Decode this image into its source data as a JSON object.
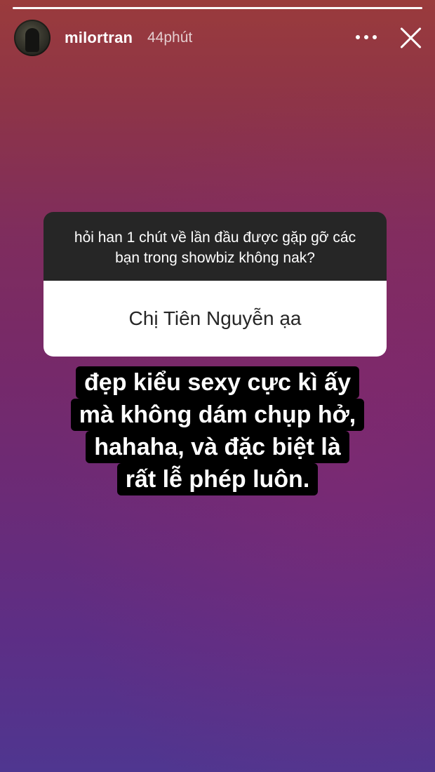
{
  "story": {
    "progress_fraction": 1.0
  },
  "header": {
    "username": "milortran",
    "timestamp": "44phút",
    "more_icon": "more-horizontal-icon",
    "close_icon": "close-icon"
  },
  "question_card": {
    "question": "hỏi han 1 chút về lần đầu được gặp gỡ các bạn trong showbiz không nak?",
    "answer": "Chị Tiên Nguyễn ạa"
  },
  "caption": {
    "lines": [
      "đẹp kiểu sexy cực kì ấy",
      "mà không dám chụp hở,",
      "hahaha, và đặc biệt là",
      "rất lễ phép luôn."
    ]
  },
  "colors": {
    "gradient_top": "#9a3b3c",
    "gradient_bottom": "#4f3690",
    "card_dark": "#262626",
    "card_light": "#ffffff",
    "caption_bg": "#000000"
  }
}
